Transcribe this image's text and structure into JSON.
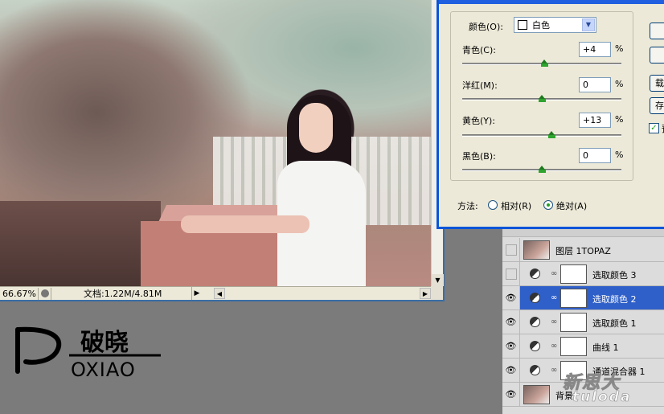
{
  "document": {
    "zoom": "66.67%",
    "doc_info": "文档:1.22M/4.81M"
  },
  "logo": {
    "chinese": "破晓",
    "latin": "OXIAO"
  },
  "dialog": {
    "colors_label": "颜色(O):",
    "colors_value": "白色",
    "sliders": [
      {
        "label": "青色(C):",
        "value": "+4",
        "unit": "%",
        "position": 0.52
      },
      {
        "label": "洋红(M):",
        "value": "0",
        "unit": "%",
        "position": 0.5
      },
      {
        "label": "黄色(Y):",
        "value": "+13",
        "unit": "%",
        "position": 0.565
      },
      {
        "label": "黑色(B):",
        "value": "0",
        "unit": "%",
        "position": 0.5
      }
    ],
    "method_label": "方法:",
    "method_relative": "相对(R)",
    "method_absolute": "绝对(A)",
    "method_selected": "absolute",
    "side_buttons": [
      "",
      "",
      "载",
      "存"
    ],
    "preview_label": "预",
    "preview_checked": true
  },
  "layers": [
    {
      "name": "图层 1TOPAZ",
      "visible": false,
      "type": "photo"
    },
    {
      "name": "选取颜色 3",
      "visible": false,
      "type": "adjustment"
    },
    {
      "name": "选取颜色 2",
      "visible": true,
      "type": "adjustment",
      "selected": true
    },
    {
      "name": "选取颜色 1",
      "visible": true,
      "type": "adjustment"
    },
    {
      "name": "曲线 1",
      "visible": true,
      "type": "adjustment"
    },
    {
      "name": "通道混合器 1",
      "visible": true,
      "type": "adjustment"
    },
    {
      "name": "背景",
      "visible": true,
      "type": "photo"
    }
  ],
  "watermark": {
    "top": "新思大",
    "bottom": "tuloda"
  }
}
